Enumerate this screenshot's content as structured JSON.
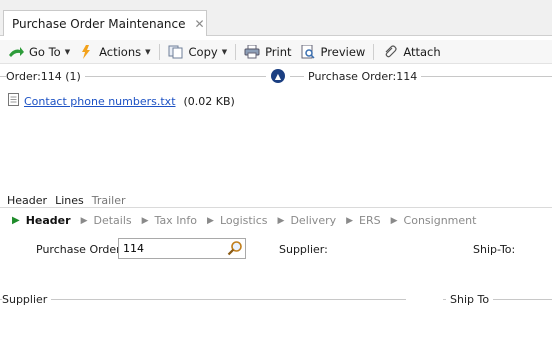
{
  "tab": {
    "title": "Purchase Order Maintenance",
    "close_glyph": "✕"
  },
  "toolbar": {
    "goto_label": "Go To",
    "actions_label": "Actions",
    "copy_label": "Copy",
    "print_label": "Print",
    "preview_label": "Preview",
    "attach_label": "Attach"
  },
  "left_group": {
    "label": "Order:114 (1)"
  },
  "right_group": {
    "label": "Purchase Order:114"
  },
  "attachment": {
    "name": "Contact phone numbers.txt",
    "size": "(0.02 KB)"
  },
  "subtabs": [
    "Header",
    "Lines",
    "Trailer"
  ],
  "steps": [
    "Header",
    "Details",
    "Tax Info",
    "Logistics",
    "Delivery",
    "ERS",
    "Consignment"
  ],
  "form": {
    "purchase_order_label": "Purchase Order:",
    "purchase_order_value": "114",
    "supplier_label": "Supplier:",
    "shipto_label": "Ship-To:"
  },
  "sections": {
    "supplier": "Supplier",
    "shipto": "Ship To"
  },
  "colors": {
    "link": "#1d52c4",
    "step_active_arrow": "#1e8c2a",
    "collapse_button": "#1b3f82"
  }
}
